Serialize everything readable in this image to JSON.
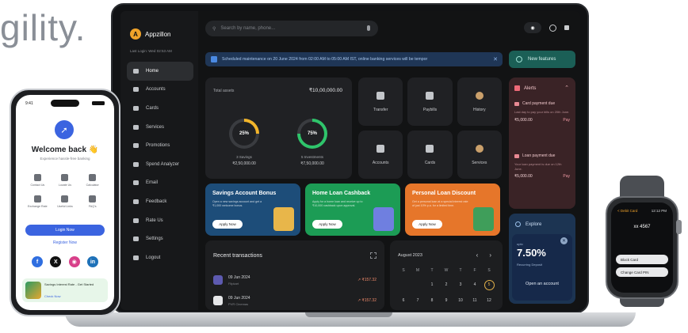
{
  "headline": "gility.",
  "laptop": {
    "brand": "Appzillon",
    "last_login": "Last Login: Wed 02:53 AM",
    "nav": [
      {
        "label": "Home",
        "icon": "home-icon"
      },
      {
        "label": "Accounts",
        "icon": "accounts-icon"
      },
      {
        "label": "Cards",
        "icon": "cards-icon"
      },
      {
        "label": "Services",
        "icon": "services-icon"
      },
      {
        "label": "Promotions",
        "icon": "promotions-icon"
      },
      {
        "label": "Spend Analyzer",
        "icon": "analyzer-icon"
      },
      {
        "label": "Email",
        "icon": "email-icon"
      },
      {
        "label": "Feedback",
        "icon": "feedback-icon"
      },
      {
        "label": "Rate Us",
        "icon": "rate-icon"
      },
      {
        "label": "Settings",
        "icon": "settings-icon"
      },
      {
        "label": "Logout",
        "icon": "logout-icon"
      }
    ],
    "search_placeholder": "Search by name, phone...",
    "banner": "Scheduled maintenance on 20 June 2024 from 02:00 AM to 05:00 AM IST, online banking services will be tempor",
    "new_features": "New features",
    "assets": {
      "label": "Total assets",
      "value": "₹10,00,000.00",
      "savings_pct": "25%",
      "savings_label": "3 Savings",
      "savings_value": "₹2,50,000.00",
      "invest_pct": "75%",
      "invest_label": "5 Investments",
      "invest_value": "₹7,50,000.00"
    },
    "quick_actions": [
      {
        "label": "Transfer",
        "icon": "transfer-icon"
      },
      {
        "label": "Paybills",
        "icon": "paybills-icon"
      },
      {
        "label": "History",
        "icon": "history-icon"
      },
      {
        "label": "Accounts",
        "icon": "bank-icon"
      },
      {
        "label": "Cards",
        "icon": "card-icon"
      },
      {
        "label": "Services",
        "icon": "services-icon"
      }
    ],
    "alerts": {
      "title": "Alerts",
      "items": [
        {
          "title": "Card payment due",
          "desc": "Last day to pay your bills on 20th June.",
          "amount": "₹5,000.00",
          "action": "Pay"
        },
        {
          "title": "Loan payment due",
          "desc": "Your loan payment is due on 12th June.",
          "amount": "₹5,000.00",
          "action": "Pay"
        }
      ]
    },
    "promos": [
      {
        "title": "Savings Account Bonus",
        "desc": "Open a new savings account and get a ₹1,000 welcome bonus.",
        "button": "Apply Now"
      },
      {
        "title": "Home Loan Cashback",
        "desc": "Apply for a home loan and receive up to ₹10,000 cashback upon approval.",
        "button": "Apply Now"
      },
      {
        "title": "Personal Loan Discount",
        "desc": "Get a personal loan at a special interest rate of just 10% p.a. for a limited time.",
        "button": "Apply Now"
      }
    ],
    "explore": {
      "title": "Explore",
      "sub": "upto",
      "rate": "7.50%",
      "desc": "Recurring Deposit",
      "cta": "Open an account"
    },
    "transactions": {
      "title": "Recent transactions",
      "rows": [
        {
          "date": "09 Jun 2024",
          "desc": "Flipkart",
          "amount": "↗ ₹157.32"
        },
        {
          "date": "09 Jun 2024",
          "desc": "PVR Cinemas",
          "amount": "↗ ₹157.32"
        }
      ]
    },
    "calendar": {
      "month": "August 2023",
      "headers": [
        "S",
        "M",
        "T",
        "W",
        "T",
        "F",
        "S"
      ],
      "days": [
        "",
        "",
        "1",
        "2",
        "3",
        "4",
        "5",
        "6",
        "7",
        "8",
        "9",
        "10",
        "11",
        "12"
      ],
      "today": "5"
    }
  },
  "phone": {
    "time": "9:41",
    "welcome": "Welcome back 👋",
    "sub": "Experience hassle-free banking",
    "shortcuts": [
      {
        "label": "Contact Us",
        "icon": "phone-icon"
      },
      {
        "label": "Locate Us",
        "icon": "locate-icon"
      },
      {
        "label": "Calculator",
        "icon": "calculator-icon"
      },
      {
        "label": "Exchange Rate",
        "icon": "exchange-icon"
      },
      {
        "label": "Useful Links",
        "icon": "link-icon"
      },
      {
        "label": "FAQ's",
        "icon": "faq-icon"
      }
    ],
    "login": "Login Now",
    "register": "Register Now",
    "promo_text": "Savings Interest Rate - Get Started",
    "promo_link": "Check Now"
  },
  "watch": {
    "title": "< Debit Card",
    "time": "12:12 PM",
    "card": "xx 4567",
    "btn1": "Block Card",
    "btn2": "Change Card PIN"
  }
}
